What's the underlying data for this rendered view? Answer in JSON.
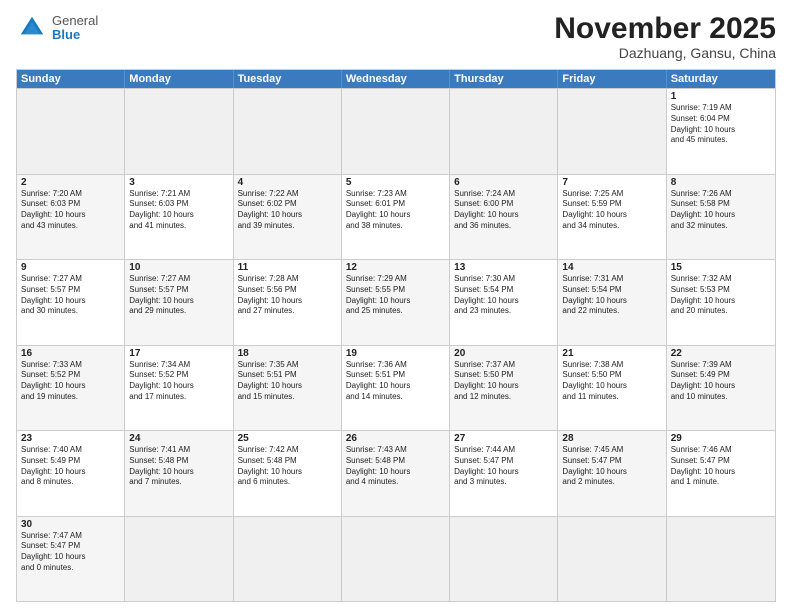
{
  "header": {
    "logo_general": "General",
    "logo_blue": "Blue",
    "month_title": "November 2025",
    "location": "Dazhuang, Gansu, China"
  },
  "weekdays": [
    "Sunday",
    "Monday",
    "Tuesday",
    "Wednesday",
    "Thursday",
    "Friday",
    "Saturday"
  ],
  "rows": [
    [
      {
        "day": "",
        "info": "",
        "empty": true
      },
      {
        "day": "",
        "info": "",
        "empty": true
      },
      {
        "day": "",
        "info": "",
        "empty": true
      },
      {
        "day": "",
        "info": "",
        "empty": true
      },
      {
        "day": "",
        "info": "",
        "empty": true
      },
      {
        "day": "",
        "info": "",
        "empty": true
      },
      {
        "day": "1",
        "info": "Sunrise: 7:19 AM\nSunset: 6:04 PM\nDaylight: 10 hours\nand 45 minutes.",
        "shade": false
      }
    ],
    [
      {
        "day": "2",
        "info": "Sunrise: 7:20 AM\nSunset: 6:03 PM\nDaylight: 10 hours\nand 43 minutes.",
        "shade": true
      },
      {
        "day": "3",
        "info": "Sunrise: 7:21 AM\nSunset: 6:03 PM\nDaylight: 10 hours\nand 41 minutes.",
        "shade": false
      },
      {
        "day": "4",
        "info": "Sunrise: 7:22 AM\nSunset: 6:02 PM\nDaylight: 10 hours\nand 39 minutes.",
        "shade": true
      },
      {
        "day": "5",
        "info": "Sunrise: 7:23 AM\nSunset: 6:01 PM\nDaylight: 10 hours\nand 38 minutes.",
        "shade": false
      },
      {
        "day": "6",
        "info": "Sunrise: 7:24 AM\nSunset: 6:00 PM\nDaylight: 10 hours\nand 36 minutes.",
        "shade": true
      },
      {
        "day": "7",
        "info": "Sunrise: 7:25 AM\nSunset: 5:59 PM\nDaylight: 10 hours\nand 34 minutes.",
        "shade": false
      },
      {
        "day": "8",
        "info": "Sunrise: 7:26 AM\nSunset: 5:58 PM\nDaylight: 10 hours\nand 32 minutes.",
        "shade": true
      }
    ],
    [
      {
        "day": "9",
        "info": "Sunrise: 7:27 AM\nSunset: 5:57 PM\nDaylight: 10 hours\nand 30 minutes.",
        "shade": false
      },
      {
        "day": "10",
        "info": "Sunrise: 7:27 AM\nSunset: 5:57 PM\nDaylight: 10 hours\nand 29 minutes.",
        "shade": true
      },
      {
        "day": "11",
        "info": "Sunrise: 7:28 AM\nSunset: 5:56 PM\nDaylight: 10 hours\nand 27 minutes.",
        "shade": false
      },
      {
        "day": "12",
        "info": "Sunrise: 7:29 AM\nSunset: 5:55 PM\nDaylight: 10 hours\nand 25 minutes.",
        "shade": true
      },
      {
        "day": "13",
        "info": "Sunrise: 7:30 AM\nSunset: 5:54 PM\nDaylight: 10 hours\nand 23 minutes.",
        "shade": false
      },
      {
        "day": "14",
        "info": "Sunrise: 7:31 AM\nSunset: 5:54 PM\nDaylight: 10 hours\nand 22 minutes.",
        "shade": true
      },
      {
        "day": "15",
        "info": "Sunrise: 7:32 AM\nSunset: 5:53 PM\nDaylight: 10 hours\nand 20 minutes.",
        "shade": false
      }
    ],
    [
      {
        "day": "16",
        "info": "Sunrise: 7:33 AM\nSunset: 5:52 PM\nDaylight: 10 hours\nand 19 minutes.",
        "shade": true
      },
      {
        "day": "17",
        "info": "Sunrise: 7:34 AM\nSunset: 5:52 PM\nDaylight: 10 hours\nand 17 minutes.",
        "shade": false
      },
      {
        "day": "18",
        "info": "Sunrise: 7:35 AM\nSunset: 5:51 PM\nDaylight: 10 hours\nand 15 minutes.",
        "shade": true
      },
      {
        "day": "19",
        "info": "Sunrise: 7:36 AM\nSunset: 5:51 PM\nDaylight: 10 hours\nand 14 minutes.",
        "shade": false
      },
      {
        "day": "20",
        "info": "Sunrise: 7:37 AM\nSunset: 5:50 PM\nDaylight: 10 hours\nand 12 minutes.",
        "shade": true
      },
      {
        "day": "21",
        "info": "Sunrise: 7:38 AM\nSunset: 5:50 PM\nDaylight: 10 hours\nand 11 minutes.",
        "shade": false
      },
      {
        "day": "22",
        "info": "Sunrise: 7:39 AM\nSunset: 5:49 PM\nDaylight: 10 hours\nand 10 minutes.",
        "shade": true
      }
    ],
    [
      {
        "day": "23",
        "info": "Sunrise: 7:40 AM\nSunset: 5:49 PM\nDaylight: 10 hours\nand 8 minutes.",
        "shade": false
      },
      {
        "day": "24",
        "info": "Sunrise: 7:41 AM\nSunset: 5:48 PM\nDaylight: 10 hours\nand 7 minutes.",
        "shade": true
      },
      {
        "day": "25",
        "info": "Sunrise: 7:42 AM\nSunset: 5:48 PM\nDaylight: 10 hours\nand 6 minutes.",
        "shade": false
      },
      {
        "day": "26",
        "info": "Sunrise: 7:43 AM\nSunset: 5:48 PM\nDaylight: 10 hours\nand 4 minutes.",
        "shade": true
      },
      {
        "day": "27",
        "info": "Sunrise: 7:44 AM\nSunset: 5:47 PM\nDaylight: 10 hours\nand 3 minutes.",
        "shade": false
      },
      {
        "day": "28",
        "info": "Sunrise: 7:45 AM\nSunset: 5:47 PM\nDaylight: 10 hours\nand 2 minutes.",
        "shade": true
      },
      {
        "day": "29",
        "info": "Sunrise: 7:46 AM\nSunset: 5:47 PM\nDaylight: 10 hours\nand 1 minute.",
        "shade": false
      }
    ],
    [
      {
        "day": "30",
        "info": "Sunrise: 7:47 AM\nSunset: 5:47 PM\nDaylight: 10 hours\nand 0 minutes.",
        "shade": true
      },
      {
        "day": "",
        "info": "",
        "empty": true
      },
      {
        "day": "",
        "info": "",
        "empty": true
      },
      {
        "day": "",
        "info": "",
        "empty": true
      },
      {
        "day": "",
        "info": "",
        "empty": true
      },
      {
        "day": "",
        "info": "",
        "empty": true
      },
      {
        "day": "",
        "info": "",
        "empty": true
      }
    ]
  ]
}
